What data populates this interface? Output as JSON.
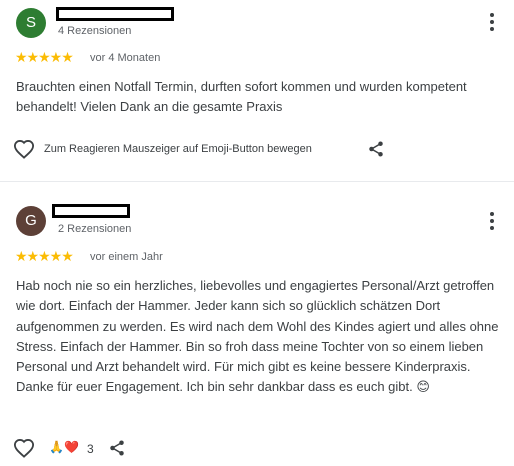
{
  "reviews": [
    {
      "avatar_letter": "S",
      "avatar_color": "#2e7d32",
      "review_count": "4 Rezensionen",
      "stars": "★★★★★",
      "age": "vor 4 Monaten",
      "text": "Brauchten einen Notfall Termin, durften sofort kommen und wurden kompetent behandelt! Vielen Dank an die gesamte Praxis",
      "reaction_hint": "Zum Reagieren Mauszeiger auf Emoji-Button bewegen",
      "heart_icon": "heart-outline-icon",
      "share_icon": "share-icon",
      "menu_icon": "more-vertical-icon"
    },
    {
      "avatar_letter": "G",
      "avatar_color": "#5d4037",
      "review_count": "2 Rezensionen",
      "stars": "★★★★★",
      "age": "vor einem Jahr",
      "text": "Hab noch nie so ein herzliches, liebevolles und engagiertes Personal/Arzt getroffen wie dort. Einfach der Hammer. Jeder kann sich so glücklich schätzen Dort aufgenommen zu werden. Es wird nach dem Wohl des Kindes agiert und alles ohne Stress. Einfach der Hammer. Bin so froh dass meine Tochter von so einem lieben Personal und Arzt behandelt wird. Für mich gibt es keine bessere Kinderpraxis. Danke für euer Engagement. Ich bin sehr dankbar dass es euch gibt. 😊",
      "reaction_emojis": "🙏❤️",
      "reaction_count": "3",
      "heart_icon": "heart-outline-icon",
      "share_icon": "share-icon",
      "menu_icon": "more-vertical-icon"
    }
  ],
  "colors": {
    "star": "#fbbc04",
    "divider": "#e8eaed",
    "text": "#3c4043",
    "secondary_text": "#5f6368"
  }
}
